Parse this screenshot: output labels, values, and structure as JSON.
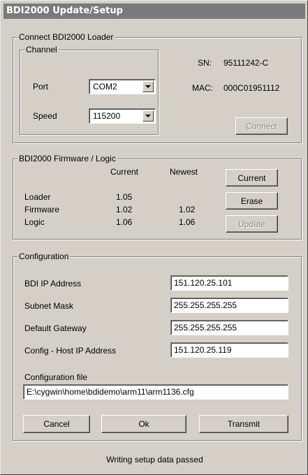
{
  "window": {
    "title": "BDI2000 Update/Setup"
  },
  "connect": {
    "legend": "Connect BDI2000 Loader",
    "channel": {
      "legend": "Channel",
      "port_label": "Port",
      "port_value": "COM2",
      "speed_label": "Speed",
      "speed_value": "115200"
    },
    "sn_label": "SN:",
    "sn_value": "95111242-C",
    "mac_label": "MAC:",
    "mac_value": "000C01951112",
    "connect_button": "Connect"
  },
  "firmware": {
    "legend": "BDI2000 Firmware / Logic",
    "col_current": "Current",
    "col_newest": "Newest",
    "rows": [
      {
        "name": "Loader",
        "current": "1.05",
        "newest": ""
      },
      {
        "name": "Firmware",
        "current": "1.02",
        "newest": "1.02"
      },
      {
        "name": "Logic",
        "current": "1.06",
        "newest": "1.06"
      }
    ],
    "current_button": "Current",
    "erase_button": "Erase",
    "update_button": "Update"
  },
  "config": {
    "legend": "Configuration",
    "fields": [
      {
        "label": "BDI IP Address",
        "value": "151.120.25.101"
      },
      {
        "label": "Subnet Mask",
        "value": "255.255.255.255"
      },
      {
        "label": "Default Gateway",
        "value": "255.255.255.255"
      },
      {
        "label": "Config - Host IP Address",
        "value": "151.120.25.119"
      }
    ],
    "file_label": "Configuration file",
    "file_value": "E:\\cygwin\\home\\bdidemo\\arm11\\arm1136.cfg",
    "cancel_button": "Cancel",
    "ok_button": "Ok",
    "transmit_button": "Transmit"
  },
  "status": {
    "text": "Writing setup data passed"
  }
}
